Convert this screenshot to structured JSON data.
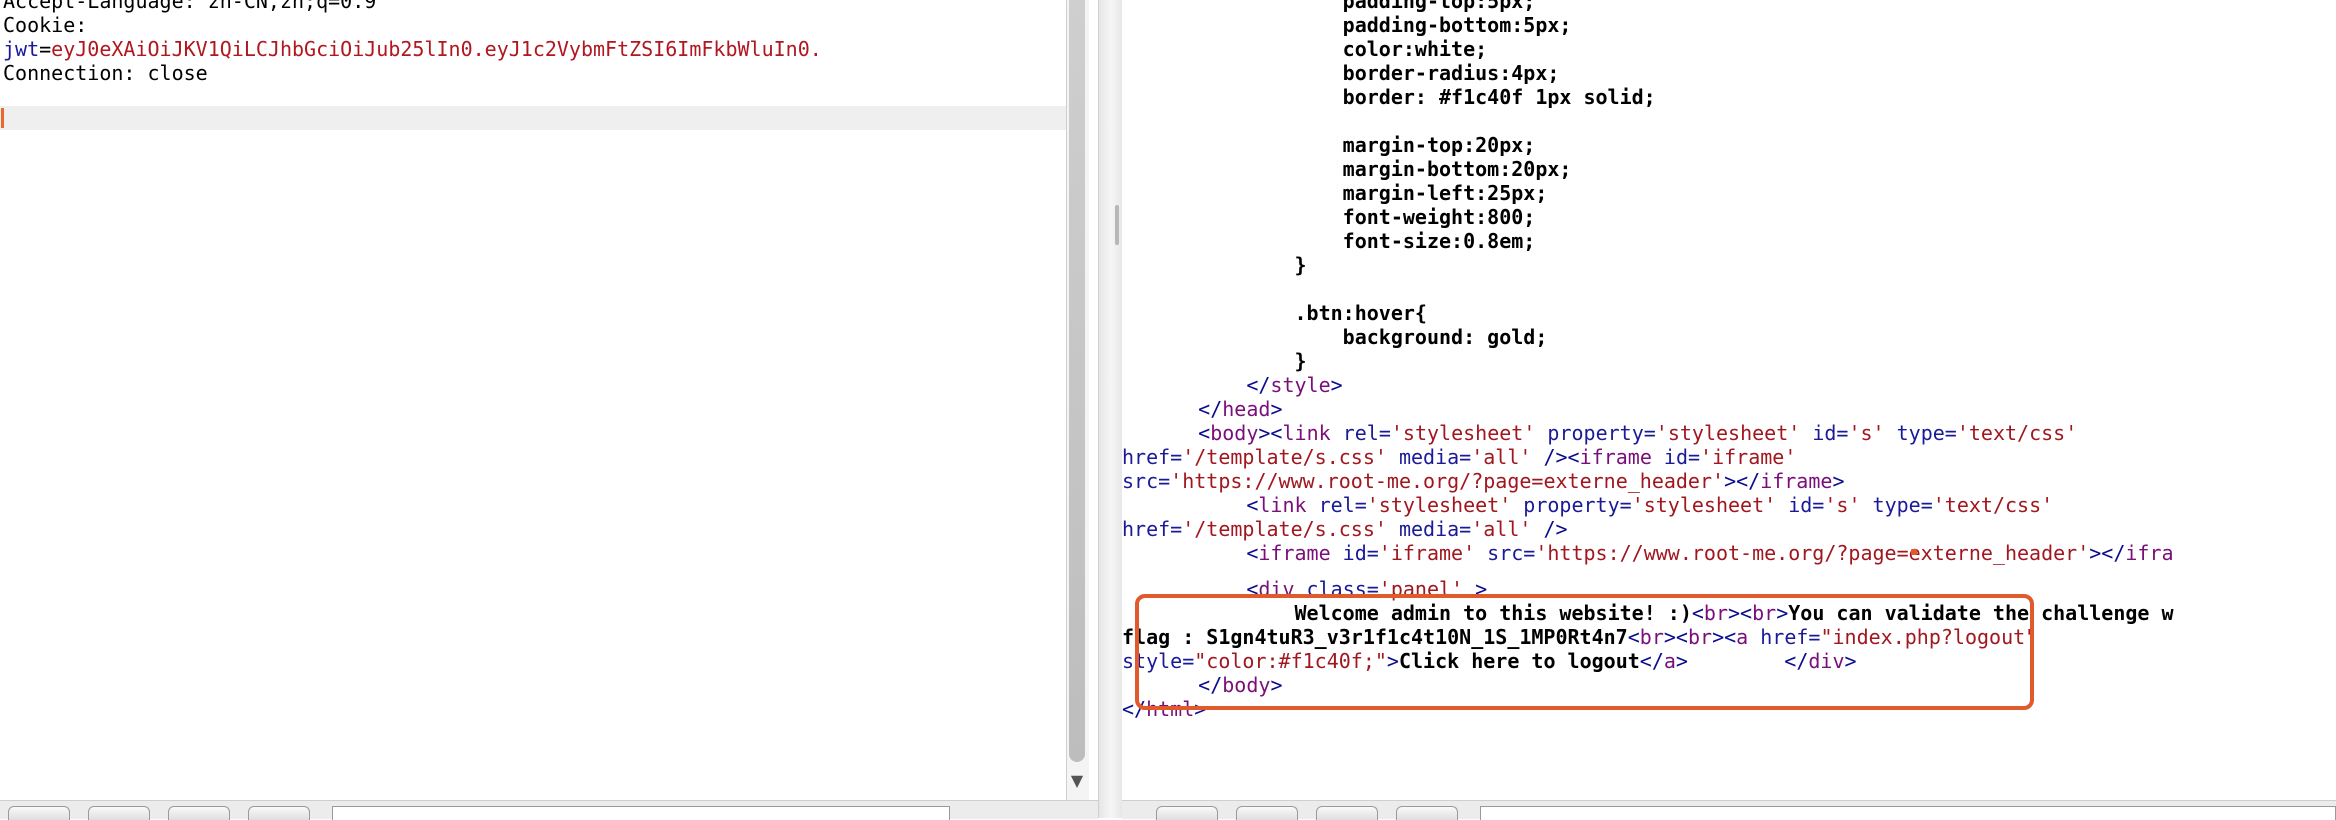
{
  "request": {
    "lines": [
      {
        "name": "Accept-Language:",
        "value": " zh-CN,zh;q=0.9"
      },
      {
        "name": "Cookie:",
        "value": ""
      },
      {
        "cookie_name": "jwt",
        "cookie_eq": "=",
        "cookie_value": "eyJ0eXAiOiJKV1QiLCJhbGciOiJub25lIn0.eyJ1c2VybmFtZSI6ImFkbWluIn0."
      },
      {
        "name": "Connection:",
        "value": " close"
      }
    ]
  },
  "response": {
    "lines": [
      {
        "indent": "                ",
        "text": "padding-top:5px;"
      },
      {
        "indent": "                ",
        "text": "padding-bottom:5px;"
      },
      {
        "indent": "                ",
        "text": "color:white;"
      },
      {
        "indent": "                ",
        "text": "border-radius:4px;"
      },
      {
        "indent": "                ",
        "text": "border: #f1c40f 1px solid;"
      },
      {
        "indent": "",
        "text": ""
      },
      {
        "indent": "                ",
        "text": "margin-top:20px;"
      },
      {
        "indent": "                ",
        "text": "margin-bottom:20px;"
      },
      {
        "indent": "                ",
        "text": "margin-left:25px;"
      },
      {
        "indent": "                ",
        "text": "font-weight:800;"
      },
      {
        "indent": "                ",
        "text": "font-size:0.8em;"
      },
      {
        "indent": "            ",
        "text": "}"
      },
      {
        "indent": "",
        "text": ""
      },
      {
        "indent": "            ",
        "text": ".btn:hover{"
      },
      {
        "indent": "                ",
        "text": "background: gold;"
      },
      {
        "indent": "            ",
        "text": "}"
      }
    ],
    "style_close": {
      "indent": "        ",
      "open": "</",
      "name": "style",
      "close": ">"
    },
    "head_close": {
      "indent": "    ",
      "open": "</",
      "name": "head",
      "close": ">"
    },
    "body_line1": {
      "indent": "    ",
      "p1": "<",
      "body": "body",
      "p2": "><",
      "link": "link",
      "a1": " rel=",
      "v1": "'stylesheet'",
      "a2": " property=",
      "v2": "'stylesheet'",
      "a3": " id=",
      "v3": "'s'",
      "a4": " type=",
      "v4": "'text/css'"
    },
    "body_line2": {
      "a1": "href=",
      "v1": "'/template/s.css'",
      "a2": " media=",
      "v2": "'all'",
      "p1": " /><",
      "iframe": "iframe",
      "a3": " id=",
      "v3": "'iframe'"
    },
    "body_line3": {
      "a1": "src=",
      "v1": "'https://www.root-me.org/?page=externe_header'",
      "p1": "></",
      "iframe": "iframe",
      "p2": ">"
    },
    "body_line4": {
      "indent": "        ",
      "p1": "<",
      "link": "link",
      "a1": " rel=",
      "v1": "'stylesheet'",
      "a2": " property=",
      "v2": "'stylesheet'",
      "a3": " id=",
      "v3": "'s'",
      "a4": " type=",
      "v4": "'text/css'"
    },
    "body_line5": {
      "a1": "href=",
      "v1": "'/template/s.css'",
      "a2": " media=",
      "v2": "'all'",
      "p1": " />"
    },
    "body_line6": {
      "indent": "        ",
      "p1": "<",
      "iframe": "iframe",
      "a1": " id=",
      "v1": "'iframe'",
      "a2": " src=",
      "v2": "'https://www.root-me.org/?page=externe_header'",
      "p2": "></",
      "iframe2": "ifra"
    },
    "div_line": {
      "indent": "        ",
      "p1": "<",
      "div": "div",
      "a1": " class=",
      "v1": "'panel'",
      "p2": " >"
    },
    "welcome_line": {
      "indent": "            ",
      "t1": "Welcome admin to this website! :)",
      "p1": "<",
      "br1": "br",
      "p2": "><",
      "br2": "br",
      "p3": ">",
      "t2": "You can validate the challenge w"
    },
    "flag_line": {
      "t1": "flag : S1gn4tuR3_v3r1f1c4t10N_1S_1MP0Rt4n7",
      "p1": "<",
      "br1": "br",
      "p2": "><",
      "br2": "br",
      "p3": "><",
      "a": "a",
      "a1": " href=",
      "v1": "\"index.php?logout\""
    },
    "style_line": {
      "a1": "style=",
      "v1": "\"color:#f1c40f;\"",
      "p1": ">",
      "t1": "Click here to logout",
      "p2": "</",
      "a": "a",
      "p3": ">",
      "gap": "        ",
      "p4": "</",
      "div": "div",
      "p5": ">"
    },
    "body_close": {
      "indent": "    ",
      "open": "</",
      "name": "body",
      "close": ">"
    },
    "html_close": {
      "open": "</",
      "name": "html",
      "close": ">"
    }
  },
  "colors": {
    "highlight_border": "#e05a2b",
    "caret": "#e8682e"
  }
}
